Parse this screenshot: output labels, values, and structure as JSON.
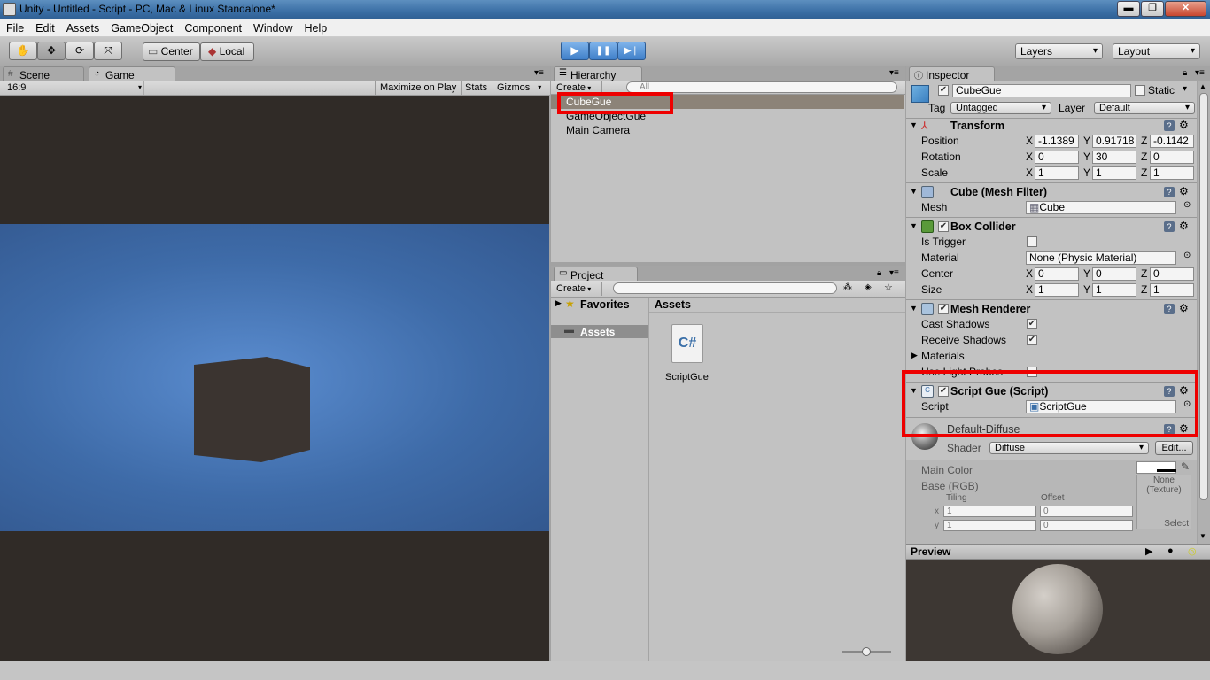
{
  "window": {
    "title": "Unity - Untitled - Script - PC, Mac & Linux Standalone*",
    "min": "▬",
    "max": "❐",
    "close": "✕"
  },
  "menubar": {
    "items": [
      "File",
      "Edit",
      "Assets",
      "GameObject",
      "Component",
      "Window",
      "Help"
    ]
  },
  "toolbar": {
    "tools": [
      "hand-icon",
      "move-icon",
      "rotate-icon",
      "scale-icon"
    ],
    "pivot": "Center",
    "space": "Local",
    "play": "▶",
    "pause": "❚❚",
    "step": "▶❘",
    "layers": "Layers",
    "layout": "Layout"
  },
  "scene_game": {
    "tab_scene": "Scene",
    "tab_game": "Game",
    "aspect": "16:9",
    "maximize": "Maximize on Play",
    "stats": "Stats",
    "gizmos": "Gizmos"
  },
  "hierarchy": {
    "tab": "Hierarchy",
    "create": "Create",
    "search_placeholder": "All",
    "items": [
      "CubeGue",
      "GameObjectGue",
      "Main Camera"
    ]
  },
  "project": {
    "tab": "Project",
    "create": "Create",
    "favorites": "Favorites",
    "assets_folder": "Assets",
    "assets_header": "Assets",
    "asset_name": "ScriptGue",
    "asset_icon_text": "C#"
  },
  "inspector": {
    "tab": "Inspector",
    "object_name": "CubeGue",
    "static": "Static",
    "tag_label": "Tag",
    "tag_value": "Untagged",
    "layer_label": "Layer",
    "layer_value": "Default",
    "transform": {
      "title": "Transform",
      "position_label": "Position",
      "position": [
        "-1.1389",
        "0.91718",
        "-0.1142"
      ],
      "rotation_label": "Rotation",
      "rotation": [
        "0",
        "30",
        "0"
      ],
      "scale_label": "Scale",
      "scale": [
        "1",
        "1",
        "1"
      ]
    },
    "mesh_filter": {
      "title": "Cube (Mesh Filter)",
      "mesh_label": "Mesh",
      "mesh_value": "Cube"
    },
    "box_collider": {
      "title": "Box Collider",
      "is_trigger": "Is Trigger",
      "material_label": "Material",
      "material_value": "None (Physic Material)",
      "center_label": "Center",
      "center": [
        "0",
        "0",
        "0"
      ],
      "size_label": "Size",
      "size": [
        "1",
        "1",
        "1"
      ]
    },
    "mesh_renderer": {
      "title": "Mesh Renderer",
      "cast_shadows": "Cast Shadows",
      "receive_shadows": "Receive Shadows",
      "materials": "Materials",
      "use_light_probes": "Use Light Probes"
    },
    "script": {
      "title": "Script Gue (Script)",
      "script_label": "Script",
      "script_value": "ScriptGue"
    },
    "material": {
      "title": "Default-Diffuse",
      "shader_label": "Shader",
      "shader_value": "Diffuse",
      "edit": "Edit...",
      "main_color": "Main Color",
      "base_rgb": "Base (RGB)",
      "tiling": "Tiling",
      "offset": "Offset",
      "x": "x",
      "y": "y",
      "tiling_x": "1",
      "offset_x": "0",
      "tiling_y": "1",
      "offset_y": "0",
      "texture_none": "None",
      "texture_type": "(Texture)",
      "select": "Select"
    },
    "preview": "Preview",
    "axis_x": "X",
    "axis_y": "Y",
    "axis_z": "Z"
  },
  "colors": {
    "game_sky": "#3d6aa6",
    "game_bg": "#302b27",
    "highlight_red": "#ee0000",
    "cube": "#3b3430"
  }
}
